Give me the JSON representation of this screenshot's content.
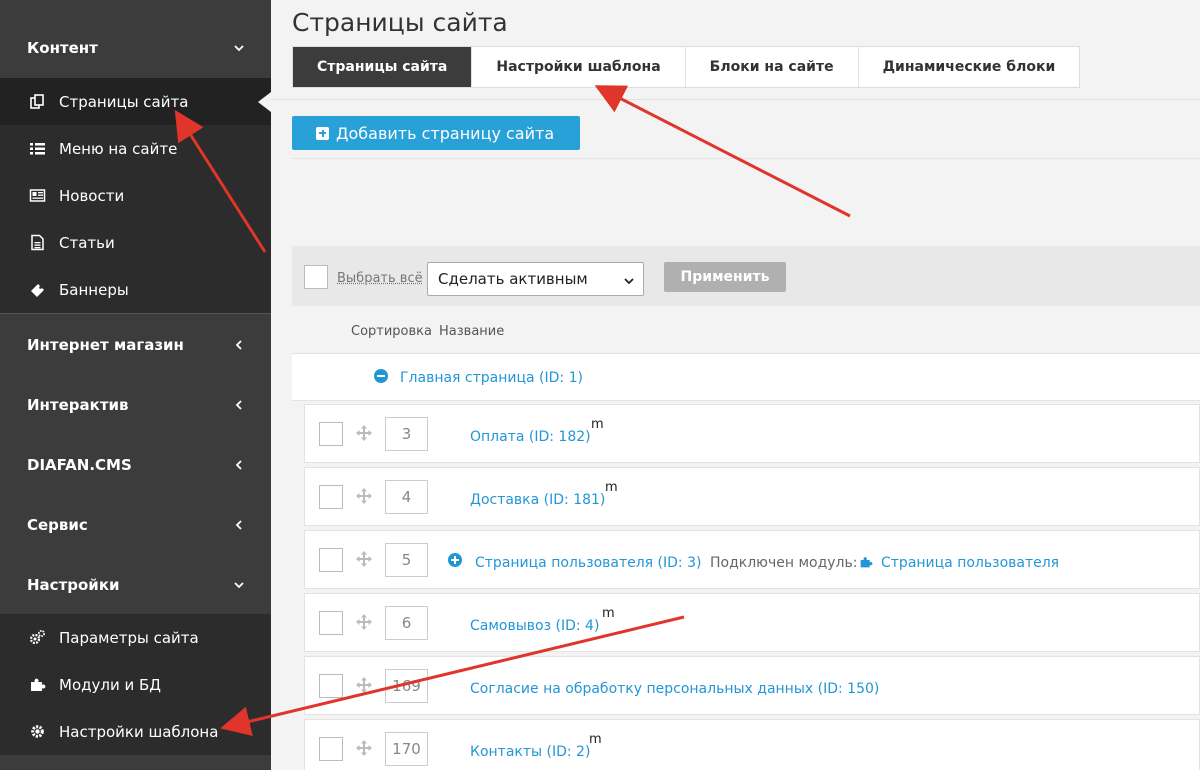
{
  "colors": {
    "sidebar_bg": "#3c3c3c",
    "sidebar_sub_bg": "#2c2c2c",
    "accent": "#28a0d8",
    "link": "#2496d6",
    "annotation_arrow": "#e0352b"
  },
  "sidebar": {
    "sections": [
      {
        "label": "Контент",
        "chevron": "chevron-down-icon"
      },
      {
        "label": "Интернет магазин",
        "chevron": "chevron-left-icon"
      },
      {
        "label": "Интерактив",
        "chevron": "chevron-left-icon"
      },
      {
        "label": "DIAFAN.CMS",
        "chevron": "chevron-left-icon"
      },
      {
        "label": "Сервис",
        "chevron": "chevron-left-icon"
      },
      {
        "label": "Настройки",
        "chevron": "chevron-down-icon"
      }
    ],
    "content_items": [
      {
        "label": "Страницы сайта",
        "icon": "pages-icon",
        "active": true
      },
      {
        "label": "Меню на сайте",
        "icon": "list-icon"
      },
      {
        "label": "Новости",
        "icon": "newspaper-icon"
      },
      {
        "label": "Статьи",
        "icon": "document-icon"
      },
      {
        "label": "Баннеры",
        "icon": "ticket-icon"
      }
    ],
    "settings_items": [
      {
        "label": "Параметры сайта",
        "icon": "cogs-icon"
      },
      {
        "label": "Модули и БД",
        "icon": "puzzle-icon"
      },
      {
        "label": "Настройки шаблона",
        "icon": "gear-icon"
      }
    ]
  },
  "main": {
    "title": "Страницы сайта",
    "tabs": [
      {
        "label": "Страницы сайта",
        "active": true
      },
      {
        "label": "Настройки шаблона"
      },
      {
        "label": "Блоки на сайте"
      },
      {
        "label": "Динамические блоки"
      }
    ],
    "add_button": "Добавить страницу сайта",
    "toolbar": {
      "select_all": "Выбрать всё",
      "action_selected": "Сделать активным",
      "apply": "Применить"
    },
    "columns": {
      "sort": "Сортировка",
      "name": "Название"
    },
    "root": {
      "name": "Главная страница (ID: 1)"
    },
    "rows": [
      {
        "sort": "3",
        "name": "Оплата (ID: 182)",
        "flag": "m"
      },
      {
        "sort": "4",
        "name": "Доставка (ID: 181)",
        "flag": "m"
      },
      {
        "sort": "5",
        "name": "Страница пользователя (ID: 3)",
        "module_label": "Подключен модуль:",
        "module": "Страница пользователя",
        "expandable": true
      },
      {
        "sort": "6",
        "name": "Самовывоз (ID: 4)",
        "flag": "m"
      },
      {
        "sort": "169",
        "name": "Согласие на обработку персональных данных (ID: 150)"
      },
      {
        "sort": "170",
        "name": "Контакты (ID: 2)",
        "flag": "m"
      }
    ]
  }
}
